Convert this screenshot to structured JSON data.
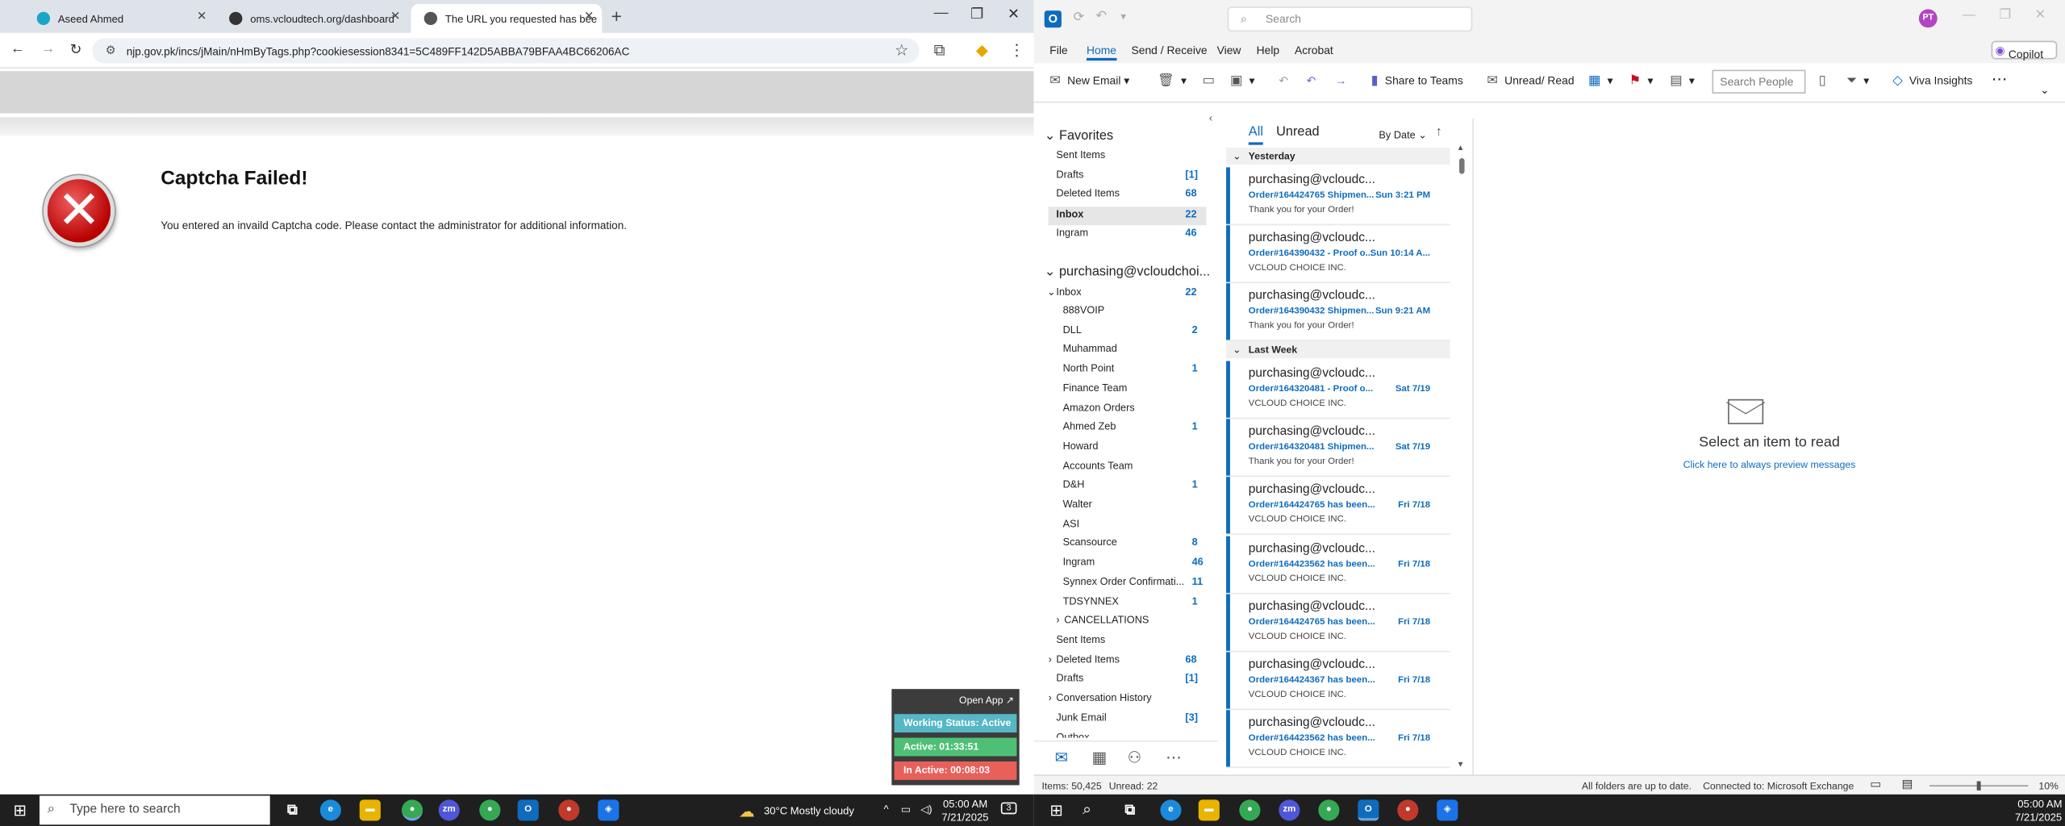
{
  "chrome": {
    "tabs": [
      {
        "title": "Aseed Ahmed"
      },
      {
        "title": "oms.vcloudtech.org/dashboard"
      },
      {
        "title": "The URL you requested has bee"
      }
    ],
    "url": "njp.gov.pk/incs/jMain/nHmByTags.php?cookiesession8341=5C489FF142D5ABBA79BFAA4BC66206AC",
    "error_title": "Captcha Failed!",
    "error_message": "You entered an invaild Captcha code. Please contact the administrator for additional information.",
    "widget": {
      "open_app": "Open App ↗",
      "working_status": "Working Status: Active",
      "active": "Active: 01:33:51",
      "inactive": "In Active: 00:08:03",
      "colors": {
        "status": "#56b7c6",
        "active": "#4ec076",
        "inactive": "#e8605a"
      }
    }
  },
  "outlook": {
    "search_placeholder": "Search",
    "avatar": "PT",
    "menu": [
      "File",
      "Home",
      "Send / Receive",
      "View",
      "Help",
      "Acrobat"
    ],
    "copilot": "Copilot",
    "ribbon": {
      "new_email": "New Email",
      "share_to_teams": "Share to Teams",
      "unread_read": "Unread/ Read",
      "search_people": "Search People",
      "viva_insights": "Viva Insights"
    },
    "favorites": {
      "title": "Favorites",
      "items": [
        {
          "label": "Sent Items",
          "count": ""
        },
        {
          "label": "Drafts",
          "count": "[1]"
        },
        {
          "label": "Deleted Items",
          "count": "68"
        },
        {
          "label": "Inbox",
          "count": "22"
        },
        {
          "label": "Ingram",
          "count": "46"
        }
      ]
    },
    "account": {
      "title": "purchasing@vcloudchoi...",
      "inbox": {
        "label": "Inbox",
        "count": "22"
      },
      "subfolders": [
        {
          "label": "888VOIP",
          "count": ""
        },
        {
          "label": "DLL",
          "count": "2"
        },
        {
          "label": "Muhammad",
          "count": ""
        },
        {
          "label": "North Point",
          "count": "1"
        },
        {
          "label": "Finance Team",
          "count": ""
        },
        {
          "label": "Amazon Orders",
          "count": ""
        },
        {
          "label": "Ahmed Zeb",
          "count": "1"
        },
        {
          "label": "Howard",
          "count": ""
        },
        {
          "label": "Accounts Team",
          "count": ""
        },
        {
          "label": "D&H",
          "count": "1"
        },
        {
          "label": "Walter",
          "count": ""
        },
        {
          "label": "ASI",
          "count": ""
        },
        {
          "label": "Scansource",
          "count": "8"
        },
        {
          "label": "Ingram",
          "count": "46"
        },
        {
          "label": "Synnex Order Confirmati...",
          "count": "11"
        },
        {
          "label": "TDSYNNEX",
          "count": "1"
        },
        {
          "label": "CANCELLATIONS",
          "count": ""
        }
      ],
      "folders": [
        {
          "label": "Sent Items",
          "count": ""
        },
        {
          "label": "Deleted Items",
          "count": "68"
        },
        {
          "label": "Drafts",
          "count": "[1]"
        },
        {
          "label": "Conversation History",
          "count": ""
        },
        {
          "label": "Junk Email",
          "count": "[3]"
        },
        {
          "label": "Outbox",
          "count": ""
        }
      ]
    },
    "list": {
      "tab_all": "All",
      "tab_unread": "Unread",
      "sort": "By Date",
      "group_yesterday": "Yesterday",
      "group_lastweek": "Last Week",
      "messages": [
        {
          "from": "purchasing@vcloudc...",
          "subject": "Order#164424765 Shipmen...",
          "date": "Sun 3:21 PM",
          "preview": "Thank you for your Order!"
        },
        {
          "from": "purchasing@vcloudc...",
          "subject": "Order#164390432 - Proof o...",
          "date": "Sun 10:14 A...",
          "preview": "VCLOUD CHOICE INC."
        },
        {
          "from": "purchasing@vcloudc...",
          "subject": "Order#164390432 Shipmen...",
          "date": "Sun 9:21 AM",
          "preview": "Thank you for your Order!"
        },
        {
          "from": "purchasing@vcloudc...",
          "subject": "Order#164320481 - Proof o...",
          "date": "Sat 7/19",
          "preview": "VCLOUD CHOICE INC."
        },
        {
          "from": "purchasing@vcloudc...",
          "subject": "Order#164320481 Shipmen...",
          "date": "Sat 7/19",
          "preview": "Thank you for your Order!"
        },
        {
          "from": "purchasing@vcloudc...",
          "subject": "Order#164424765 has been...",
          "date": "Fri 7/18",
          "preview": "VCLOUD CHOICE INC."
        },
        {
          "from": "purchasing@vcloudc...",
          "subject": "Order#164423562 has been...",
          "date": "Fri 7/18",
          "preview": "VCLOUD CHOICE INC."
        },
        {
          "from": "purchasing@vcloudc...",
          "subject": "Order#164424765 has been...",
          "date": "Fri 7/18",
          "preview": "VCLOUD CHOICE INC."
        },
        {
          "from": "purchasing@vcloudc...",
          "subject": "Order#164424367 has been...",
          "date": "Fri 7/18",
          "preview": "VCLOUD CHOICE INC."
        },
        {
          "from": "purchasing@vcloudc...",
          "subject": "Order#164423562 has been...",
          "date": "Fri 7/18",
          "preview": "VCLOUD CHOICE INC."
        }
      ]
    },
    "reading": {
      "title": "Select an item to read",
      "link": "Click here to always preview messages"
    },
    "status": {
      "items": "Items: 50,425",
      "unread": "Unread: 22",
      "sync": "All folders are up to date.",
      "connection": "Connected to: Microsoft Exchange",
      "zoom": "10%"
    }
  },
  "taskbar": {
    "search_placeholder": "Type here to search",
    "weather": "30°C  Mostly cloudy",
    "time": "05:00 AM",
    "date": "7/21/2025",
    "notifications": "3"
  }
}
